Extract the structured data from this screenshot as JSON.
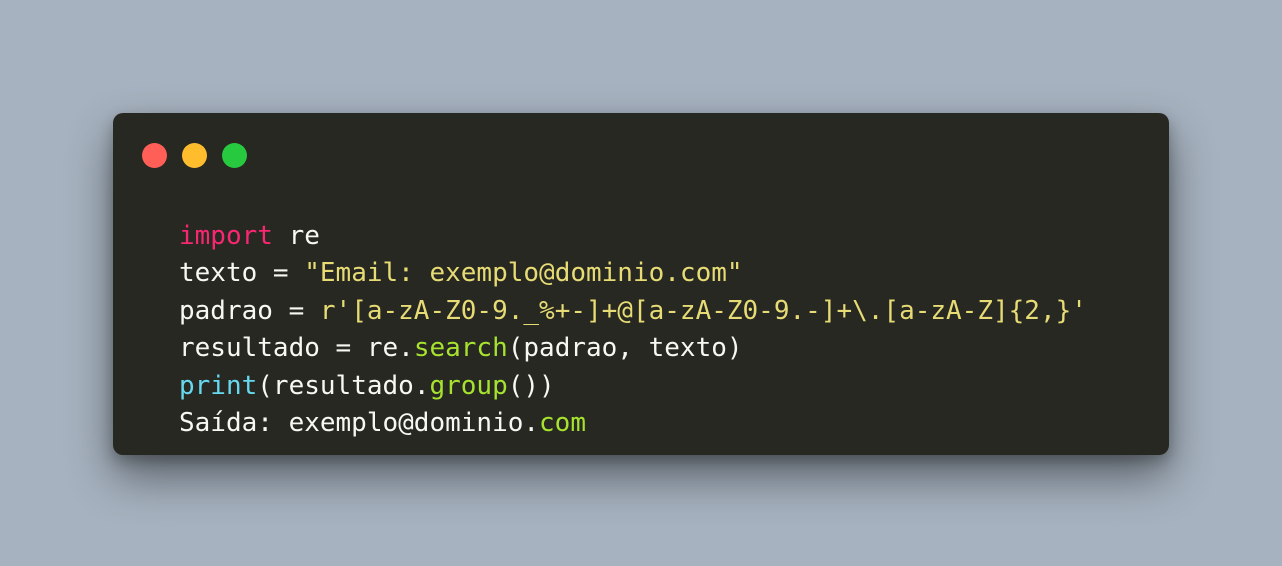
{
  "colors": {
    "background": "#a6b2bf",
    "window": "#272822",
    "text": "#f8f8f2",
    "keyword": "#f92672",
    "string": "#e6db74",
    "function": "#a6e22e",
    "builtin": "#66d9ef",
    "traffic_red": "#ff5f56",
    "traffic_yellow": "#ffbd2e",
    "traffic_green": "#27c93f"
  },
  "code": {
    "line1": {
      "keyword": "import",
      "rest": " re"
    },
    "line2": {
      "prefix": "texto = ",
      "string": "\"Email: exemplo@dominio.com\""
    },
    "line3": {
      "prefix": "padrao = ",
      "string": "r'[a-zA-Z0-9._%+-]+@[a-zA-Z0-9.-]+\\.[a-zA-Z]{2,}'"
    },
    "line4": {
      "prefix": "resultado = re.",
      "method": "search",
      "suffix": "(padrao, texto)"
    },
    "line5": {
      "builtin": "print",
      "middle": "(resultado.",
      "method": "group",
      "suffix": "())"
    },
    "line6": {
      "prefix": "Saída: exemplo@dominio.",
      "tail": "com"
    }
  }
}
